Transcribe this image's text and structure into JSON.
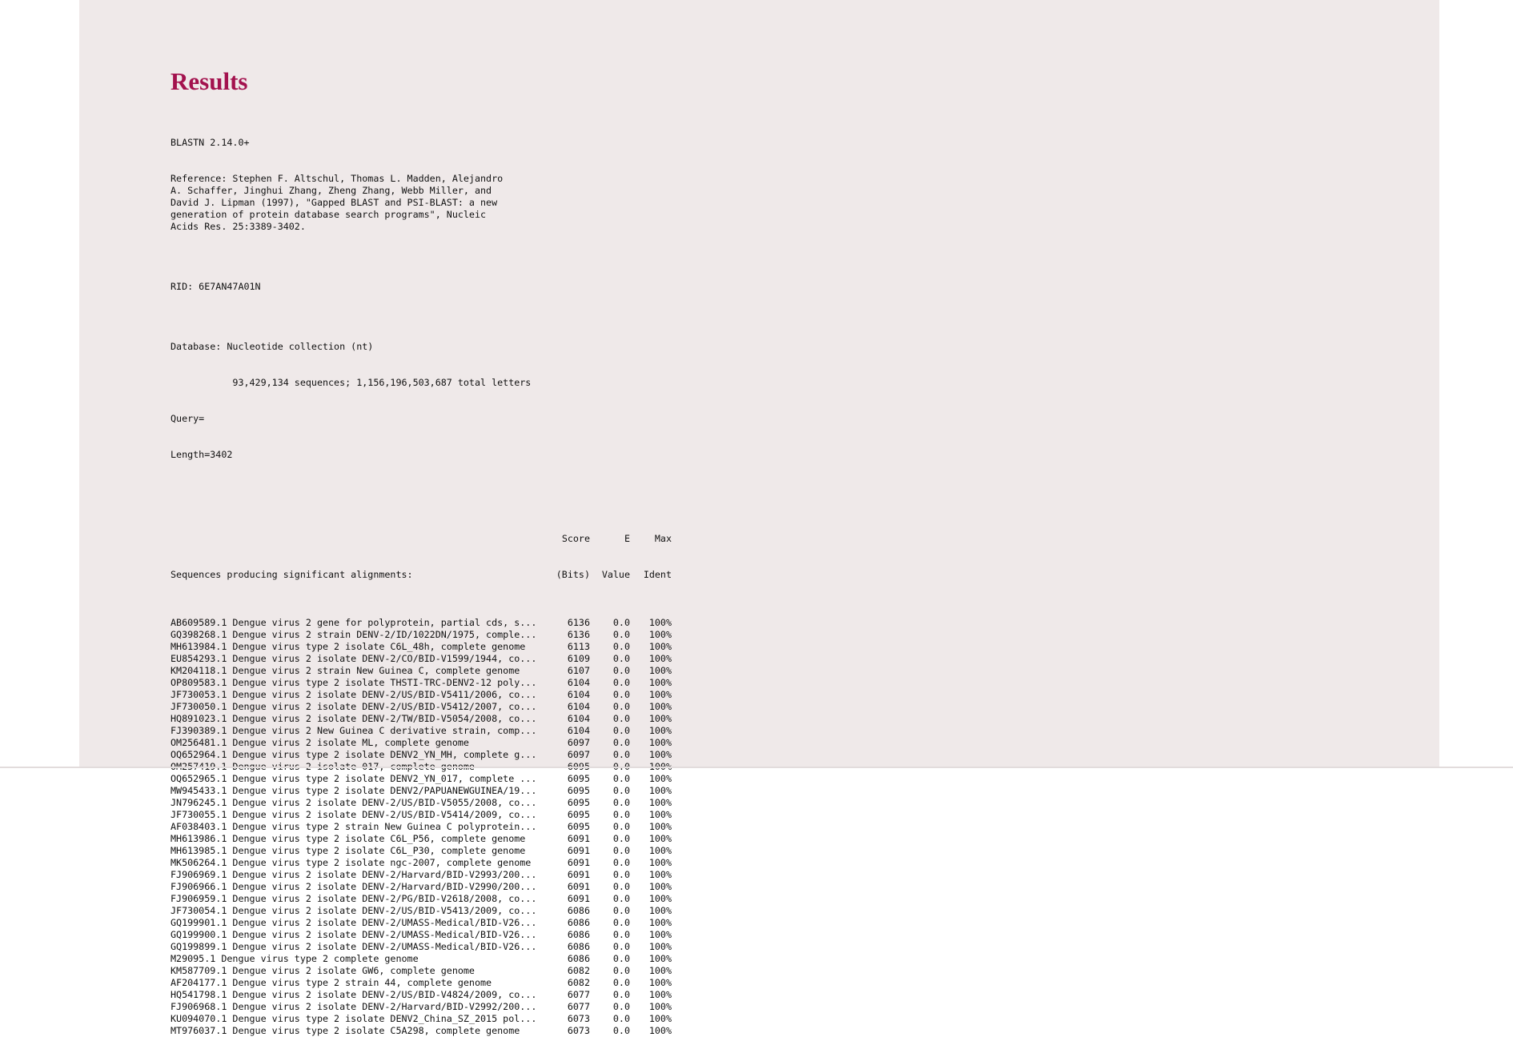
{
  "page": {
    "title": "Results"
  },
  "header": {
    "program": "BLASTN 2.14.0+",
    "reference_lines": [
      "Reference: Stephen F. Altschul, Thomas L. Madden, Alejandro",
      "A. Schaffer, Jinghui Zhang, Zheng Zhang, Webb Miller, and",
      "David J. Lipman (1997), \"Gapped BLAST and PSI-BLAST: a new",
      "generation of protein database search programs\", Nucleic",
      "Acids Res. 25:3389-3402."
    ],
    "rid": "RID: 6E7AN47A01N",
    "database": "Database: Nucleotide collection (nt)",
    "database_stats": "           93,429,134 sequences; 1,156,196,503,687 total letters",
    "query": "Query=",
    "length": "Length=3402"
  },
  "table": {
    "headers": {
      "desc_top": "",
      "desc": "Sequences producing significant alignments:",
      "score_top": "Score",
      "score": "(Bits)",
      "eval_top": "E",
      "eval": "Value",
      "ident_top": "Max",
      "ident": "Ident"
    },
    "rows": [
      {
        "desc": "AB609589.1 Dengue virus 2 gene for polyprotein, partial cds, s...",
        "score": "6136",
        "eval": "0.0",
        "ident": "100%"
      },
      {
        "desc": "GQ398268.1 Dengue virus 2 strain DENV-2/ID/1022DN/1975, comple...",
        "score": "6136",
        "eval": "0.0",
        "ident": "100%"
      },
      {
        "desc": "MH613984.1 Dengue virus type 2 isolate C6L_48h, complete genome",
        "score": "6113",
        "eval": "0.0",
        "ident": "100%"
      },
      {
        "desc": "EU854293.1 Dengue virus 2 isolate DENV-2/CO/BID-V1599/1944, co...",
        "score": "6109",
        "eval": "0.0",
        "ident": "100%"
      },
      {
        "desc": "KM204118.1 Dengue virus 2 strain New Guinea C, complete genome",
        "score": "6107",
        "eval": "0.0",
        "ident": "100%"
      },
      {
        "desc": "OP809583.1 Dengue virus type 2 isolate THSTI-TRC-DENV2-12 poly...",
        "score": "6104",
        "eval": "0.0",
        "ident": "100%"
      },
      {
        "desc": "JF730053.1 Dengue virus 2 isolate DENV-2/US/BID-V5411/2006, co...",
        "score": "6104",
        "eval": "0.0",
        "ident": "100%"
      },
      {
        "desc": "JF730050.1 Dengue virus 2 isolate DENV-2/US/BID-V5412/2007, co...",
        "score": "6104",
        "eval": "0.0",
        "ident": "100%"
      },
      {
        "desc": "HQ891023.1 Dengue virus 2 isolate DENV-2/TW/BID-V5054/2008, co...",
        "score": "6104",
        "eval": "0.0",
        "ident": "100%"
      },
      {
        "desc": "FJ390389.1 Dengue virus 2 New Guinea C derivative strain, comp...",
        "score": "6104",
        "eval": "0.0",
        "ident": "100%"
      },
      {
        "desc": "OM256481.1 Dengue virus 2 isolate ML, complete genome",
        "score": "6097",
        "eval": "0.0",
        "ident": "100%"
      },
      {
        "desc": "OQ652964.1 Dengue virus type 2 isolate DENV2_YN_MH, complete g...",
        "score": "6097",
        "eval": "0.0",
        "ident": "100%"
      },
      {
        "desc": "OM257419.1 Dengue virus 2 isolate 017, complete genome",
        "score": "6095",
        "eval": "0.0",
        "ident": "100%"
      },
      {
        "desc": "OQ652965.1 Dengue virus type 2 isolate DENV2_YN_017, complete ...",
        "score": "6095",
        "eval": "0.0",
        "ident": "100%"
      },
      {
        "desc": "MW945433.1 Dengue virus type 2 isolate DENV2/PAPUANEWGUINEA/19...",
        "score": "6095",
        "eval": "0.0",
        "ident": "100%"
      },
      {
        "desc": "JN796245.1 Dengue virus 2 isolate DENV-2/US/BID-V5055/2008, co...",
        "score": "6095",
        "eval": "0.0",
        "ident": "100%"
      },
      {
        "desc": "JF730055.1 Dengue virus 2 isolate DENV-2/US/BID-V5414/2009, co...",
        "score": "6095",
        "eval": "0.0",
        "ident": "100%"
      },
      {
        "desc": "AF038403.1 Dengue virus type 2 strain New Guinea C polyprotein...",
        "score": "6095",
        "eval": "0.0",
        "ident": "100%"
      },
      {
        "desc": "MH613986.1 Dengue virus type 2 isolate C6L_P56, complete genome",
        "score": "6091",
        "eval": "0.0",
        "ident": "100%"
      },
      {
        "desc": "MH613985.1 Dengue virus type 2 isolate C6L_P30, complete genome",
        "score": "6091",
        "eval": "0.0",
        "ident": "100%"
      },
      {
        "desc": "MK506264.1 Dengue virus type 2 isolate ngc-2007, complete genome",
        "score": "6091",
        "eval": "0.0",
        "ident": "100%"
      },
      {
        "desc": "FJ906969.1 Dengue virus 2 isolate DENV-2/Harvard/BID-V2993/200...",
        "score": "6091",
        "eval": "0.0",
        "ident": "100%"
      },
      {
        "desc": "FJ906966.1 Dengue virus 2 isolate DENV-2/Harvard/BID-V2990/200...",
        "score": "6091",
        "eval": "0.0",
        "ident": "100%"
      },
      {
        "desc": "FJ906959.1 Dengue virus 2 isolate DENV-2/PG/BID-V2618/2008, co...",
        "score": "6091",
        "eval": "0.0",
        "ident": "100%"
      },
      {
        "desc": "JF730054.1 Dengue virus 2 isolate DENV-2/US/BID-V5413/2009, co...",
        "score": "6086",
        "eval": "0.0",
        "ident": "100%"
      },
      {
        "desc": "GQ199901.1 Dengue virus 2 isolate DENV-2/UMASS-Medical/BID-V26...",
        "score": "6086",
        "eval": "0.0",
        "ident": "100%"
      },
      {
        "desc": "GQ199900.1 Dengue virus 2 isolate DENV-2/UMASS-Medical/BID-V26...",
        "score": "6086",
        "eval": "0.0",
        "ident": "100%"
      },
      {
        "desc": "GQ199899.1 Dengue virus 2 isolate DENV-2/UMASS-Medical/BID-V26...",
        "score": "6086",
        "eval": "0.0",
        "ident": "100%"
      },
      {
        "desc": "M29095.1 Dengue virus type 2 complete genome",
        "score": "6086",
        "eval": "0.0",
        "ident": "100%"
      },
      {
        "desc": "KM587709.1 Dengue virus 2 isolate GW6, complete genome",
        "score": "6082",
        "eval": "0.0",
        "ident": "100%"
      },
      {
        "desc": "AF204177.1 Dengue virus type 2 strain 44, complete genome",
        "score": "6082",
        "eval": "0.0",
        "ident": "100%"
      },
      {
        "desc": "HQ541798.1 Dengue virus 2 isolate DENV-2/US/BID-V4824/2009, co...",
        "score": "6077",
        "eval": "0.0",
        "ident": "100%"
      },
      {
        "desc": "FJ906968.1 Dengue virus 2 isolate DENV-2/Harvard/BID-V2992/200...",
        "score": "6077",
        "eval": "0.0",
        "ident": "100%"
      },
      {
        "desc": "KU094070.1 Dengue virus type 2 isolate DENV2_China_SZ_2015 pol...",
        "score": "6073",
        "eval": "0.0",
        "ident": "100%"
      },
      {
        "desc": "MT976037.1 Dengue virus type 2 isolate C5A298, complete genome",
        "score": "6073",
        "eval": "0.0",
        "ident": "100%"
      }
    ]
  },
  "colors": {
    "title": "#a3124e",
    "panel_background": "#efe9e9",
    "page_background": "#ffffff",
    "text": "#111111"
  }
}
